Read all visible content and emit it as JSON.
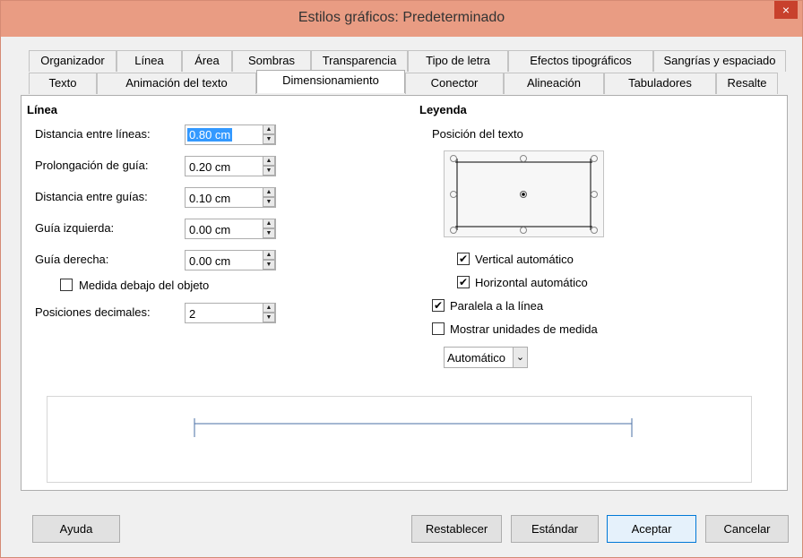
{
  "window": {
    "title": "Estilos gráficos: Predeterminado",
    "close": "×"
  },
  "tabs_row1": [
    "Organizador",
    "Línea",
    "Área",
    "Sombras",
    "Transparencia",
    "Tipo de letra",
    "Efectos tipográficos",
    "Sangrías y espaciado"
  ],
  "tabs_row2": [
    "Texto",
    "Animación del texto",
    "Dimensionamiento",
    "Conector",
    "Alineación",
    "Tabuladores",
    "Resalte"
  ],
  "active_tab": "Dimensionamiento",
  "line_section": {
    "heading": "Línea",
    "fields": [
      {
        "label": "Distancia entre líneas:",
        "value": "0.80 cm"
      },
      {
        "label": "Prolongación de guía:",
        "value": "0.20 cm"
      },
      {
        "label": "Distancia entre guías:",
        "value": "0.10 cm"
      },
      {
        "label": "Guía izquierda:",
        "value": "0.00 cm"
      },
      {
        "label": "Guía derecha:",
        "value": "0.00 cm"
      }
    ],
    "below_object_label": "Medida debajo del objeto",
    "below_object_checked": false,
    "decimals_label": "Posiciones decimales:",
    "decimals_value": "2"
  },
  "legend_section": {
    "heading": "Leyenda",
    "text_position_label": "Posición del texto",
    "vertical_auto_label": "Vertical automático",
    "vertical_auto_checked": true,
    "horizontal_auto_label": "Horizontal automático",
    "horizontal_auto_checked": true,
    "parallel_label": "Paralela a la línea",
    "parallel_checked": true,
    "show_units_label": "Mostrar unidades de medida",
    "show_units_checked": false,
    "unit_select_value": "Automático"
  },
  "buttons": {
    "help": "Ayuda",
    "reset": "Restablecer",
    "standard": "Estándar",
    "ok": "Aceptar",
    "cancel": "Cancelar"
  },
  "colors": {
    "titlebar": "#e99c83",
    "selection": "#3399ff",
    "close": "#c8412c"
  },
  "check_glyph": "✔"
}
